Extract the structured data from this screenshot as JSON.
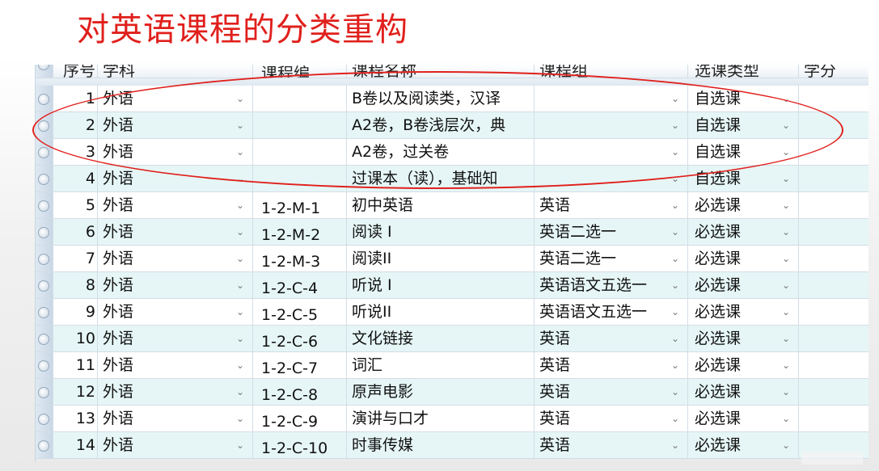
{
  "slide": {
    "title": "对英语课程的分类重构"
  },
  "table": {
    "columns": [
      "序号",
      "学科",
      "课程编",
      "课程名称",
      "课程组",
      "选课类型",
      "学分"
    ],
    "rows": [
      {
        "no": "1",
        "subject": "外语",
        "code": "",
        "name": "B卷以及阅读类，汉译",
        "group": "",
        "type": "自选课",
        "credit": ""
      },
      {
        "no": "2",
        "subject": "外语",
        "code": "",
        "name": "A2卷，B卷浅层次，典",
        "group": "",
        "type": "自选课",
        "credit": ""
      },
      {
        "no": "3",
        "subject": "外语",
        "code": "",
        "name": "A2卷，过关卷",
        "group": "",
        "type": "自选课",
        "credit": ""
      },
      {
        "no": "4",
        "subject": "外语",
        "code": "",
        "name": "过课本（读），基础知",
        "group": "",
        "type": "自选课",
        "credit": ""
      },
      {
        "no": "5",
        "subject": "外语",
        "code": "1-2-M-1",
        "name": "初中英语",
        "group": "英语",
        "type": "必选课",
        "credit": ""
      },
      {
        "no": "6",
        "subject": "外语",
        "code": "1-2-M-2",
        "name": "阅读 I",
        "group": "英语二选一",
        "type": "必选课",
        "credit": ""
      },
      {
        "no": "7",
        "subject": "外语",
        "code": "1-2-M-3",
        "name": "阅读II",
        "group": "英语二选一",
        "type": "必选课",
        "credit": ""
      },
      {
        "no": "8",
        "subject": "外语",
        "code": "1-2-C-4",
        "name": "听说 I",
        "group": "英语语文五选一",
        "type": "必选课",
        "credit": ""
      },
      {
        "no": "9",
        "subject": "外语",
        "code": "1-2-C-5",
        "name": "听说II",
        "group": "英语语文五选一",
        "type": "必选课",
        "credit": ""
      },
      {
        "no": "10",
        "subject": "外语",
        "code": "1-2-C-6",
        "name": "文化链接",
        "group": "英语",
        "type": "必选课",
        "credit": ""
      },
      {
        "no": "11",
        "subject": "外语",
        "code": "1-2-C-7",
        "name": "词汇",
        "group": "英语",
        "type": "必选课",
        "credit": ""
      },
      {
        "no": "12",
        "subject": "外语",
        "code": "1-2-C-8",
        "name": "原声电影",
        "group": "英语",
        "type": "必选课",
        "credit": ""
      },
      {
        "no": "13",
        "subject": "外语",
        "code": "1-2-C-9",
        "name": "演讲与口才",
        "group": "英语",
        "type": "必选课",
        "credit": ""
      },
      {
        "no": "14",
        "subject": "外语",
        "code": "1-2-C-10",
        "name": "时事传媒",
        "group": "英语",
        "type": "必选课",
        "credit": ""
      }
    ]
  },
  "icons": {
    "dropdown": "chevron-down-icon",
    "row_selector": "radio-icon"
  },
  "colors": {
    "title": "#e0201c",
    "highlight_ellipse": "#e0201c",
    "row_alt": "#e6f6f6"
  }
}
